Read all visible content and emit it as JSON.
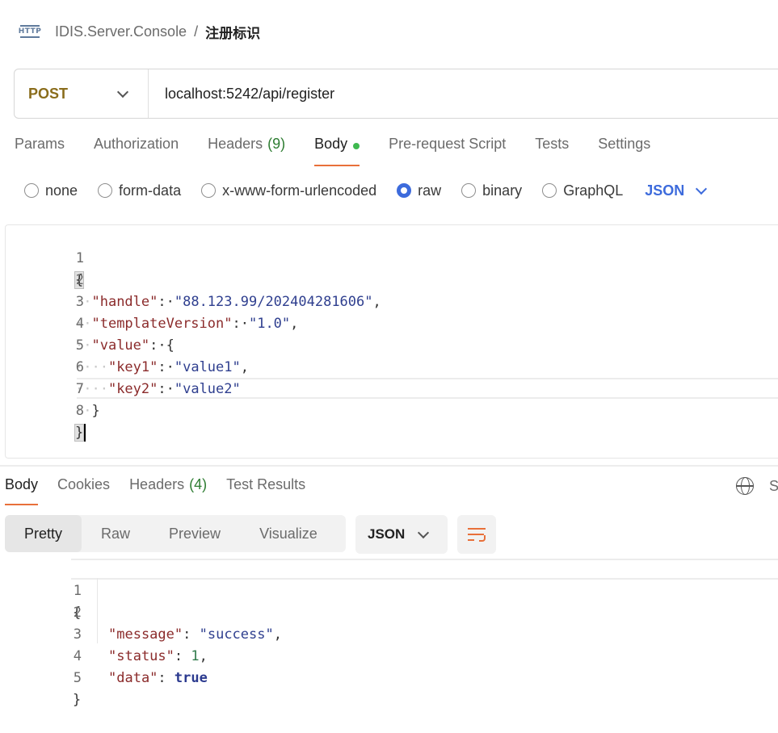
{
  "breadcrumb": {
    "icon": "http-icon",
    "icon_text": "HTTP",
    "parent": "IDIS.Server.Console",
    "separator": "/",
    "current": "注册标识"
  },
  "request": {
    "method": "POST",
    "url": "localhost:5242/api/register"
  },
  "request_tabs": [
    {
      "label": "Params"
    },
    {
      "label": "Authorization"
    },
    {
      "label": "Headers",
      "count": "(9)"
    },
    {
      "label": "Body",
      "active": true
    },
    {
      "label": "Pre-request Script"
    },
    {
      "label": "Tests"
    },
    {
      "label": "Settings"
    }
  ],
  "body_types": [
    {
      "label": "none",
      "checked": false
    },
    {
      "label": "form-data",
      "checked": false
    },
    {
      "label": "x-www-form-urlencoded",
      "checked": false
    },
    {
      "label": "raw",
      "checked": true
    },
    {
      "label": "binary",
      "checked": false
    },
    {
      "label": "GraphQL",
      "checked": false
    }
  ],
  "body_format": "JSON",
  "request_body_lines": [
    {
      "n": "1",
      "indent": "",
      "text": "{"
    },
    {
      "n": "2",
      "indent": "··",
      "key": "\"handle\"",
      "sep": ":·",
      "value": "\"88.123.99/202404281606\"",
      "tail": ","
    },
    {
      "n": "3",
      "indent": "··",
      "key": "\"templateVersion\"",
      "sep": ":·",
      "value": "\"1.0\"",
      "tail": ","
    },
    {
      "n": "4",
      "indent": "··",
      "key": "\"value\"",
      "sep": ":·",
      "value": "{",
      "tail": ""
    },
    {
      "n": "5",
      "indent": "····",
      "key": "\"key1\"",
      "sep": ":·",
      "value": "\"value1\"",
      "tail": ","
    },
    {
      "n": "6",
      "indent": "····",
      "key": "\"key2\"",
      "sep": ":·",
      "value": "\"value2\"",
      "tail": ""
    },
    {
      "n": "7",
      "indent": "··",
      "text": "}"
    },
    {
      "n": "8",
      "indent": "",
      "text": "}"
    }
  ],
  "response_tabs": [
    {
      "label": "Body",
      "active": true
    },
    {
      "label": "Cookies"
    },
    {
      "label": "Headers",
      "count": "(4)"
    },
    {
      "label": "Test Results"
    }
  ],
  "response_right_truncated": "S",
  "response_views": [
    "Pretty",
    "Raw",
    "Preview",
    "Visualize"
  ],
  "response_format": "JSON",
  "response_body_lines": [
    {
      "n": "1",
      "text": "{"
    },
    {
      "n": "2",
      "key": "\"message\"",
      "value": "\"success\"",
      "type": "string",
      "tail": ","
    },
    {
      "n": "3",
      "key": "\"status\"",
      "value": "1",
      "type": "number",
      "tail": ","
    },
    {
      "n": "4",
      "key": "\"data\"",
      "value": "true",
      "type": "bool",
      "tail": ""
    },
    {
      "n": "5",
      "text": "}"
    }
  ],
  "colors": {
    "accent_orange": "#e8703a",
    "method_post": "#8a6d1c",
    "link_blue": "#3d6bdc",
    "json_key": "#8b2b2b",
    "json_string": "#2f3f8f",
    "success_green": "#3fb950"
  }
}
